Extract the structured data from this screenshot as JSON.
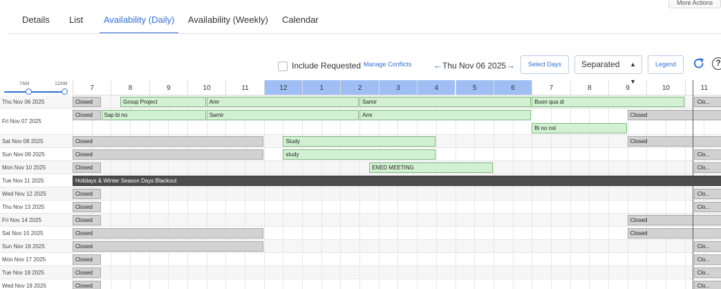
{
  "top_button": "More Actions",
  "tabs": [
    {
      "label": "Details",
      "active": false
    },
    {
      "label": "List",
      "active": false
    },
    {
      "label": "Availability (Daily)",
      "active": true
    },
    {
      "label": "Availability (Weekly)",
      "active": false
    },
    {
      "label": "Calendar",
      "active": false
    }
  ],
  "toolbar": {
    "include_requested": "Include Requested",
    "include_requested_checked": false,
    "manage_conflicts": "Manage Conflicts",
    "prev_arrow": "←",
    "current_date": "Thu Nov 06 2025",
    "next_arrow": "→",
    "select_days": "Select Days",
    "view_mode": "Separated",
    "legend": "Legend",
    "refresh_icon": "refresh-icon",
    "help_icon": "?"
  },
  "time_slider": {
    "start": "7AM",
    "end": "12AM"
  },
  "hours": [
    {
      "label": "7",
      "highlight": false
    },
    {
      "label": "8",
      "highlight": false
    },
    {
      "label": "9",
      "highlight": false
    },
    {
      "label": "10",
      "highlight": false
    },
    {
      "label": "11",
      "highlight": false
    },
    {
      "label": "12",
      "highlight": true
    },
    {
      "label": "1",
      "highlight": true
    },
    {
      "label": "2",
      "highlight": true
    },
    {
      "label": "3",
      "highlight": true
    },
    {
      "label": "4",
      "highlight": true
    },
    {
      "label": "5",
      "highlight": true
    },
    {
      "label": "6",
      "highlight": true
    },
    {
      "label": "7",
      "highlight": false
    },
    {
      "label": "8",
      "highlight": false
    },
    {
      "label": "9",
      "highlight": false
    },
    {
      "label": "10",
      "highlight": false
    },
    {
      "label": "11",
      "highlight": false
    }
  ],
  "colors": {
    "accent": "#2f6fd6",
    "closed": "#d2d2d2",
    "booking": "#d2f0d2",
    "blackout": "#4c4c4c",
    "highlight_hours": "#9fbff4"
  },
  "rows": [
    {
      "date": "Thu Nov 06 2025",
      "lines": 1,
      "bars": [
        {
          "type": "closed",
          "label": "Closed",
          "line": 0,
          "start": 0,
          "end": 0.75
        },
        {
          "type": "booking",
          "label": "Group Project",
          "line": 0,
          "start": 1.25,
          "end": 3.5
        },
        {
          "type": "booking",
          "label": "Amr",
          "line": 0,
          "start": 3.5,
          "end": 7.5
        },
        {
          "type": "booking",
          "label": "Samir",
          "line": 0,
          "start": 7.5,
          "end": 12
        },
        {
          "type": "booking",
          "label": "Buon qua di",
          "line": 0,
          "start": 12,
          "end": 16
        },
        {
          "type": "closed",
          "label": "Clo...",
          "line": 0,
          "start": 16.25,
          "end": 17
        }
      ]
    },
    {
      "date": "Fri Nov 07 2025",
      "lines": 2,
      "bars": [
        {
          "type": "closed",
          "label": "Closed",
          "line": 0,
          "start": 0,
          "end": 0.75
        },
        {
          "type": "booking",
          "label": "Sap bi no",
          "line": 0,
          "start": 0.75,
          "end": 3.5
        },
        {
          "type": "booking",
          "label": "Samir",
          "line": 0,
          "start": 3.5,
          "end": 7.5
        },
        {
          "type": "booking",
          "label": "Amr",
          "line": 0,
          "start": 7.5,
          "end": 12
        },
        {
          "type": "closed",
          "label": "Closed",
          "line": 0,
          "start": 14.5,
          "end": 17
        },
        {
          "type": "booking",
          "label": "Bi no roii",
          "line": 1,
          "start": 12,
          "end": 14.5
        }
      ]
    },
    {
      "date": "Sat Nov 08 2025",
      "lines": 1,
      "bars": [
        {
          "type": "closed",
          "label": "Closed",
          "line": 0,
          "start": 0,
          "end": 5
        },
        {
          "type": "booking",
          "label": "Study",
          "line": 0,
          "start": 5.5,
          "end": 9.5
        },
        {
          "type": "closed",
          "label": "Closed",
          "line": 0,
          "start": 14.5,
          "end": 17
        }
      ]
    },
    {
      "date": "Sun Nov 09 2025",
      "lines": 1,
      "bars": [
        {
          "type": "closed",
          "label": "Closed",
          "line": 0,
          "start": 0,
          "end": 5
        },
        {
          "type": "booking",
          "label": "study",
          "line": 0,
          "start": 5.5,
          "end": 9.5
        },
        {
          "type": "closed",
          "label": "Clo...",
          "line": 0,
          "start": 16.25,
          "end": 17
        }
      ]
    },
    {
      "date": "Mon Nov 10 2025",
      "lines": 1,
      "bars": [
        {
          "type": "closed",
          "label": "Closed",
          "line": 0,
          "start": 0,
          "end": 0.75
        },
        {
          "type": "booking",
          "label": "ENED MEETING",
          "line": 0,
          "start": 7.75,
          "end": 11
        },
        {
          "type": "closed",
          "label": "Clo...",
          "line": 0,
          "start": 16.25,
          "end": 17
        }
      ]
    },
    {
      "date": "Tue Nov 11 2025",
      "lines": 1,
      "bars": [
        {
          "type": "blackout",
          "label": "Holidays & Winter Season Days Blackout",
          "line": 0,
          "start": 0,
          "end": 17
        }
      ]
    },
    {
      "date": "Wed Nov 12 2025",
      "lines": 1,
      "bars": [
        {
          "type": "closed",
          "label": "Closed",
          "line": 0,
          "start": 0,
          "end": 0.75
        },
        {
          "type": "closed",
          "label": "Clo...",
          "line": 0,
          "start": 16.25,
          "end": 17
        }
      ]
    },
    {
      "date": "Thu Nov 13 2025",
      "lines": 1,
      "bars": [
        {
          "type": "closed",
          "label": "Closed",
          "line": 0,
          "start": 0,
          "end": 0.75
        },
        {
          "type": "closed",
          "label": "Clo...",
          "line": 0,
          "start": 16.25,
          "end": 17
        }
      ]
    },
    {
      "date": "Fri Nov 14 2025",
      "lines": 1,
      "bars": [
        {
          "type": "closed",
          "label": "Closed",
          "line": 0,
          "start": 0,
          "end": 0.75
        },
        {
          "type": "closed",
          "label": "Closed",
          "line": 0,
          "start": 14.5,
          "end": 17
        }
      ]
    },
    {
      "date": "Sat Nov 15 2025",
      "lines": 1,
      "bars": [
        {
          "type": "closed",
          "label": "Closed",
          "line": 0,
          "start": 0,
          "end": 5
        },
        {
          "type": "closed",
          "label": "Closed",
          "line": 0,
          "start": 14.5,
          "end": 17
        }
      ]
    },
    {
      "date": "Sun Nov 16 2025",
      "lines": 1,
      "bars": [
        {
          "type": "closed",
          "label": "Closed",
          "line": 0,
          "start": 0,
          "end": 5
        },
        {
          "type": "closed",
          "label": "Clo...",
          "line": 0,
          "start": 16.25,
          "end": 17
        }
      ]
    },
    {
      "date": "Mon Nov 17 2025",
      "lines": 1,
      "bars": [
        {
          "type": "closed",
          "label": "Closed",
          "line": 0,
          "start": 0,
          "end": 0.75
        },
        {
          "type": "closed",
          "label": "Clo...",
          "line": 0,
          "start": 16.25,
          "end": 17
        }
      ]
    },
    {
      "date": "Tue Nov 18 2025",
      "lines": 1,
      "bars": [
        {
          "type": "closed",
          "label": "Closed",
          "line": 0,
          "start": 0,
          "end": 0.75
        },
        {
          "type": "closed",
          "label": "Clo...",
          "line": 0,
          "start": 16.25,
          "end": 17
        }
      ]
    },
    {
      "date": "Wed Nov 19 2025",
      "lines": 1,
      "bars": [
        {
          "type": "closed",
          "label": "Closed",
          "line": 0,
          "start": 0,
          "end": 0.75
        },
        {
          "type": "closed",
          "label": "Clo...",
          "line": 0,
          "start": 16.25,
          "end": 17
        }
      ]
    }
  ]
}
